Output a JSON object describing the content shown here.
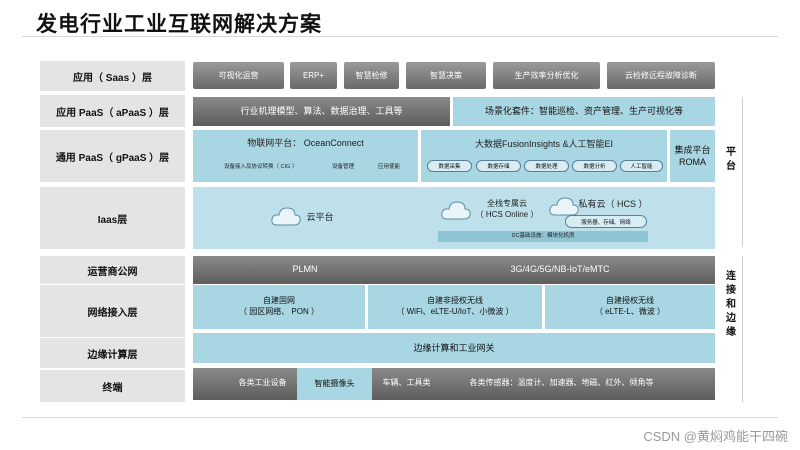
{
  "title": "发电行业工业互联网解决方案",
  "layers": {
    "saas": "应用（ Saas ）层",
    "apaas": "应用 PaaS（ aPaaS ）层",
    "gpaas": "通用 PaaS（ gPaaS ）层",
    "iaas": "Iaas层",
    "carrier": "运营商公网",
    "network": "网络接入层",
    "edge": "边缘计算层",
    "terminal": "终端"
  },
  "saas_items": [
    "可视化运营",
    "ERP+",
    "智慧检修",
    "智慧决策",
    "生产效率分析优化",
    "云检修远程故障诊断"
  ],
  "apaas": {
    "left": "行业机理模型、算法、数据治理、工具等",
    "right": "场景化套件：智能巡检、资产管理、生产可视化等"
  },
  "gpaas": {
    "iot_title": "物联网平台： OceanConnect",
    "iot_sub1": "设备接入及协议转换（ CIG ）",
    "iot_sub2": "设备管理",
    "iot_sub3": "应用使能",
    "bigdata_title": "大数据FusionInsights &人工智能EI",
    "pills": [
      "数据采集",
      "数据存储",
      "数据处理",
      "数据分析",
      "人工智能"
    ],
    "roma": "集成平台\nROMA"
  },
  "iaas": {
    "cloud": "云平台",
    "private_cloud_dedicated": "全栈专属云\n（ HCS Online ）",
    "private_cloud": "私有云（ HCS ）",
    "pill": "服务器、存储、网络",
    "dc": "DC基础设施：模块化机房"
  },
  "carrier": {
    "left": "PLMN",
    "right": "3G/4G/5G/NB-IoT/eMTC"
  },
  "network": {
    "a": "自建固网\n（ 园区网络、 PON ）",
    "b": "自建非授权无线\n（ WiFi、eLTE-U/IoT、小微波 ）",
    "c": "自建授权无线\n（ eLTE-L、微波 ）"
  },
  "edge": "边缘计算和工业网关",
  "terminal": {
    "a": "各类工业设备",
    "b": "智能摄像头",
    "c": "车辆、工具类",
    "d": "各类传感器：温度计、加速器、地磁、红外、倾角等"
  },
  "side": {
    "platform": "平台",
    "edge": "连接和边缘"
  },
  "watermark": "CSDN @黄焖鸡能干四碗",
  "colors": {
    "teal": "#a9d6e3",
    "dark_gray": "#6a6a6a",
    "label_gray": "#e4e4e4"
  }
}
